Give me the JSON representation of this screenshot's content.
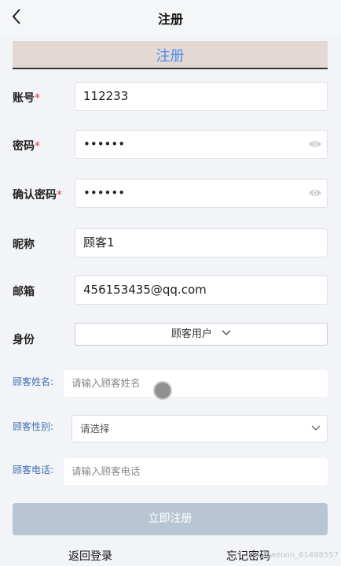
{
  "nav": {
    "title": "注册"
  },
  "banner": {
    "text": "注册"
  },
  "fields": {
    "account": {
      "label": "账号",
      "required": "*",
      "value": "112233"
    },
    "password": {
      "label": "密码",
      "required": "*",
      "value": "••••••"
    },
    "confirm": {
      "label": "确认密码",
      "required": "*",
      "value": "••••••"
    },
    "nickname": {
      "label": "昵称",
      "value": "顾客1"
    },
    "email": {
      "label": "邮箱",
      "value": "456153435@qq.com"
    },
    "identity": {
      "label": "身份",
      "value": "顾客用户"
    }
  },
  "customer": {
    "name": {
      "label": "顾客姓名:",
      "placeholder": "请输入顾客姓名"
    },
    "gender": {
      "label": "顾客性别:",
      "placeholder": "请选择"
    },
    "phone": {
      "label": "顾客电话:",
      "placeholder": "请输入顾客电话"
    }
  },
  "actions": {
    "submit": "立即注册",
    "back_login": "返回登录",
    "forgot": "忘记密码"
  },
  "watermark": "@weixin_61498557",
  "icons": [
    "back-arrow-icon",
    "eye-icon",
    "chevron-down-icon"
  ],
  "colors": {
    "accent": "#4a8ee8",
    "required": "#e03a3a",
    "button": "#b8c6d4"
  }
}
